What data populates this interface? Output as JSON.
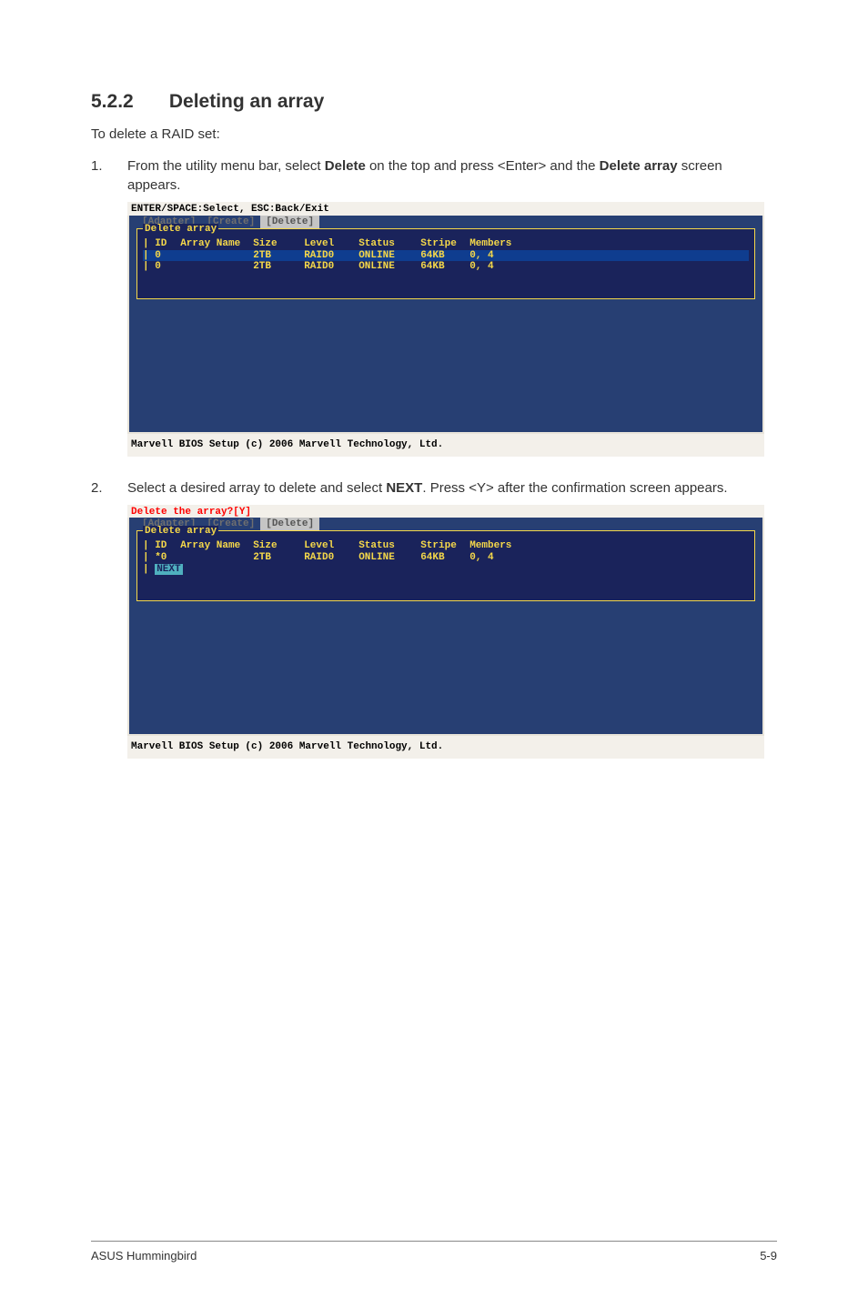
{
  "heading": {
    "num": "5.2.2",
    "title": "Deleting an array"
  },
  "intro": "To delete a RAID set:",
  "steps": [
    {
      "idx": "1.",
      "pre": "From the utility menu bar, select ",
      "b1": "Delete",
      "mid": " on the top and press <Enter> and the ",
      "b2": "Delete array",
      "post": " screen appears."
    },
    {
      "idx": "2.",
      "pre": "Select a desired array to delete and select ",
      "b1": "NEXT",
      "mid": ". Press <Y> after the confirmation screen appears.",
      "b2": "",
      "post": ""
    }
  ],
  "bios1": {
    "top": "ENTER/SPACE:Select, ESC:Back/Exit",
    "menu": [
      "[Adapter]",
      "[Create]",
      "[Delete]"
    ],
    "boxtitle": "Delete array",
    "headers": {
      "id": "ID",
      "name": "Array Name",
      "size": "Size",
      "level": "Level",
      "status": "Status",
      "stripe": "Stripe",
      "members": "Members"
    },
    "rows": [
      {
        "id": "0",
        "name": "",
        "size": "2TB",
        "level": "RAID0",
        "status": "ONLINE",
        "stripe": "64KB",
        "members": "0, 4",
        "sel": true
      },
      {
        "id": "0",
        "name": "",
        "size": "2TB",
        "level": "RAID0",
        "status": "ONLINE",
        "stripe": "64KB",
        "members": "0, 4",
        "sel": false
      }
    ],
    "foot": "Marvell BIOS Setup (c) 2006 Marvell Technology, Ltd."
  },
  "bios2": {
    "top": "Delete the array?[Y]",
    "menu": [
      "[Adapter]",
      "[Create]",
      "[Delete]"
    ],
    "boxtitle": "Delete array",
    "headers": {
      "id": "ID",
      "name": "Array Name",
      "size": "Size",
      "level": "Level",
      "status": "Status",
      "stripe": "Stripe",
      "members": "Members"
    },
    "rows": [
      {
        "id": "*0",
        "name": "",
        "size": "2TB",
        "level": "RAID0",
        "status": "ONLINE",
        "stripe": "64KB",
        "members": "0, 4",
        "sel": false
      }
    ],
    "next": "NEXT",
    "foot": "Marvell BIOS Setup (c) 2006 Marvell Technology, Ltd."
  },
  "footer": {
    "left": "ASUS Hummingbird",
    "right": "5-9"
  }
}
